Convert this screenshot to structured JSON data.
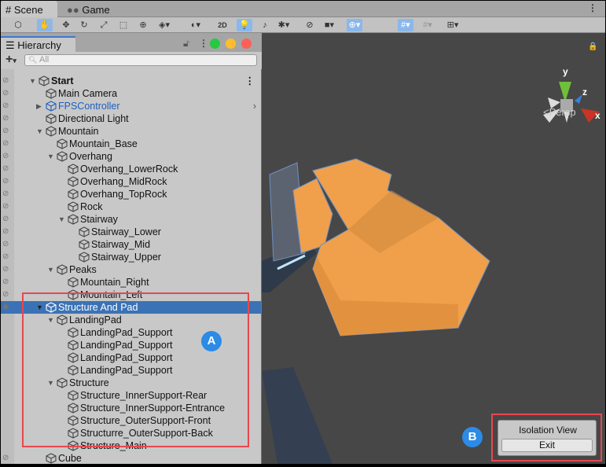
{
  "tabs": [
    {
      "label": "Scene",
      "icon": "grid-icon"
    },
    {
      "label": "Game",
      "icon": "gamepad-icon"
    }
  ],
  "toolbar": {
    "two_d": "2D"
  },
  "hierarchy": {
    "title": "Hierarchy",
    "search_placeholder": "All",
    "rows": [
      {
        "label": "Start",
        "depth": 0,
        "arrow": true,
        "type": "scene",
        "bold": true
      },
      {
        "label": "Main Camera",
        "depth": 1
      },
      {
        "label": "FPSController",
        "depth": 1,
        "arrow": "right",
        "prefab": true
      },
      {
        "label": "Directional Light",
        "depth": 1
      },
      {
        "label": "Mountain",
        "depth": 1,
        "arrow": true
      },
      {
        "label": "Mountain_Base",
        "depth": 2
      },
      {
        "label": "Overhang",
        "depth": 2,
        "arrow": true
      },
      {
        "label": "Overhang_LowerRock",
        "depth": 3
      },
      {
        "label": "Overhang_MidRock",
        "depth": 3
      },
      {
        "label": "Overhang_TopRock",
        "depth": 3
      },
      {
        "label": "Rock",
        "depth": 3
      },
      {
        "label": "Stairway",
        "depth": 3,
        "arrow": true
      },
      {
        "label": "Stairway_Lower",
        "depth": 4
      },
      {
        "label": "Stairway_Mid",
        "depth": 4
      },
      {
        "label": "Stairway_Upper",
        "depth": 4
      },
      {
        "label": "Peaks",
        "depth": 2,
        "arrow": true
      },
      {
        "label": "Mountain_Right",
        "depth": 3
      },
      {
        "label": "Mountain_Left",
        "depth": 3
      },
      {
        "label": "Structure And Pad",
        "depth": 1,
        "arrow": true,
        "selected": true
      },
      {
        "label": "LandingPad",
        "depth": 2,
        "arrow": true,
        "noeye": true
      },
      {
        "label": "LandingPad_Support",
        "depth": 3,
        "noeye": true
      },
      {
        "label": "LandingPad_Support",
        "depth": 3,
        "noeye": true
      },
      {
        "label": "LandingPad_Support",
        "depth": 3,
        "noeye": true
      },
      {
        "label": "LandingPad_Support",
        "depth": 3,
        "noeye": true
      },
      {
        "label": "Structure",
        "depth": 2,
        "arrow": true,
        "noeye": true
      },
      {
        "label": "Structure_InnerSupport-Rear",
        "depth": 3,
        "noeye": true
      },
      {
        "label": "Structure_InnerSupport-Entrance",
        "depth": 3,
        "noeye": true
      },
      {
        "label": "Structure_OuterSupport-Front",
        "depth": 3,
        "noeye": true
      },
      {
        "label": "Structurre_OuterSupport-Back",
        "depth": 3,
        "noeye": true
      },
      {
        "label": "Structure_Main",
        "depth": 3,
        "noeye": true
      },
      {
        "label": "Cube",
        "depth": 1
      }
    ]
  },
  "scene": {
    "projection": "Persp",
    "axes": {
      "x": "x",
      "y": "y",
      "z": "z"
    }
  },
  "isolation": {
    "title": "Isolation View",
    "exit_label": "Exit"
  },
  "annotations": {
    "a": "A",
    "b": "B"
  },
  "colors": {
    "selection": "#3b72b5",
    "prefab": "#1d5fc2",
    "annotation_box": "#e8474f",
    "badge": "#2b8be6",
    "mesh": "#f0a04b"
  }
}
